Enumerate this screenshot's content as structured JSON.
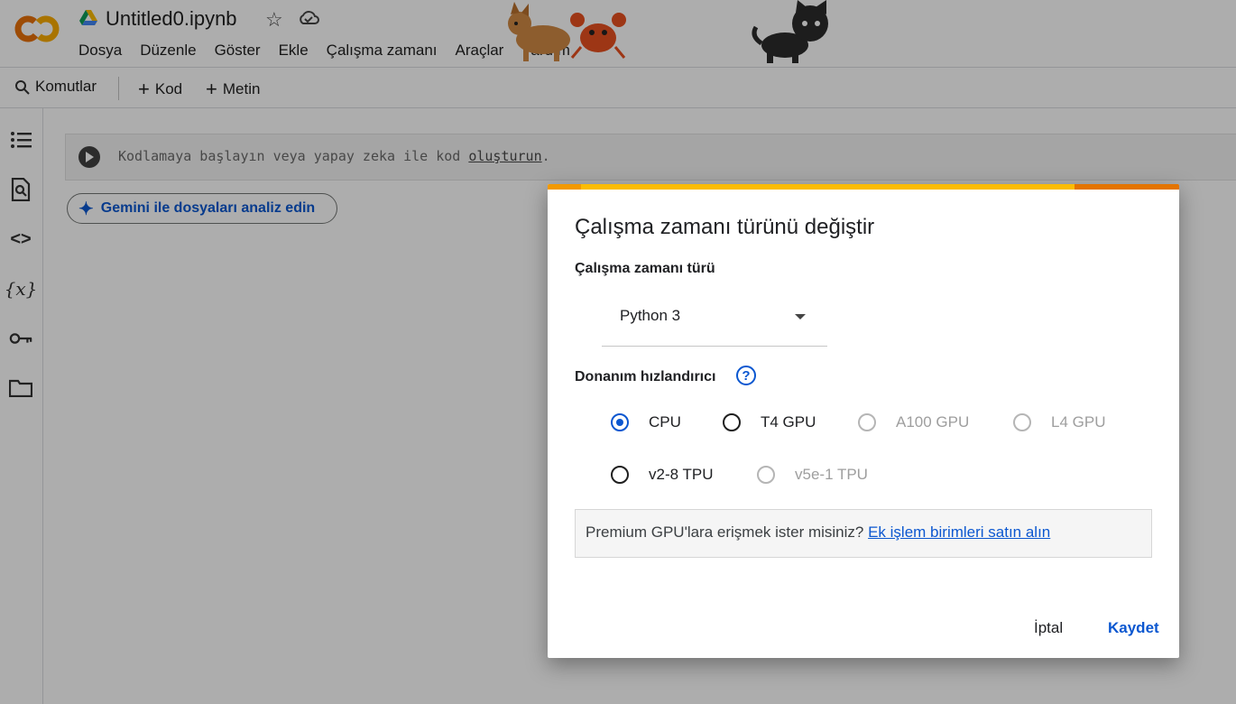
{
  "app": {
    "notebook_title": "Untitled0.ipynb",
    "menu": [
      "Dosya",
      "Düzenle",
      "Göster",
      "Ekle",
      "Çalışma zamanı",
      "Araçlar",
      "Yardım"
    ]
  },
  "toolbar": {
    "commands_label": "Komutlar",
    "code_label": "Kod",
    "text_label": "Metin"
  },
  "sidebar": {
    "icons": [
      "toc-icon",
      "find-icon",
      "code-snippets-icon",
      "variables-icon",
      "secrets-key-icon",
      "folder-icon"
    ]
  },
  "cell": {
    "placeholder_prefix": "Kodlamaya başlayın veya yapay zeka ile kod ",
    "placeholder_link": "oluşturun",
    "placeholder_suffix": "."
  },
  "gemini": {
    "label": "Gemini ile dosyaları analiz edin"
  },
  "dialog": {
    "title": "Çalışma zamanı türünü değiştir",
    "runtime_type_label": "Çalışma zamanı türü",
    "runtime_type_value": "Python 3",
    "accelerator_label": "Donanım hızlandırıcı",
    "help_symbol": "?",
    "accelerators": [
      {
        "label": "CPU",
        "selected": true,
        "disabled": false
      },
      {
        "label": "T4 GPU",
        "selected": false,
        "disabled": false
      },
      {
        "label": "A100 GPU",
        "selected": false,
        "disabled": true
      },
      {
        "label": "L4 GPU",
        "selected": false,
        "disabled": true
      },
      {
        "label": "v2-8 TPU",
        "selected": false,
        "disabled": false
      },
      {
        "label": "v5e-1 TPU",
        "selected": false,
        "disabled": true
      }
    ],
    "premium_text": "Premium GPU'lara erişmek ister misiniz?",
    "premium_link": "Ek işlem birimleri satın alın",
    "cancel_label": "İptal",
    "save_label": "Kaydet"
  },
  "colors": {
    "accent": "#0b57d0",
    "stripe": "#fbbc04",
    "stripe_edge": "#e37400"
  }
}
